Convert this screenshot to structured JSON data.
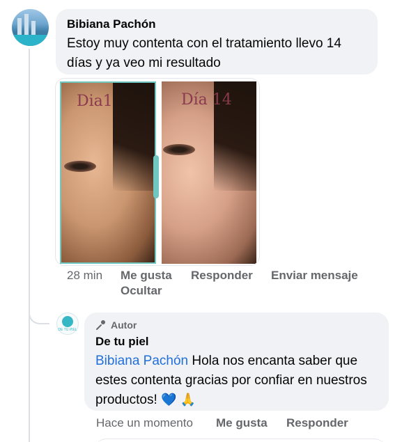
{
  "comment1": {
    "author": "Bibiana Pachón",
    "text": "Estoy muy contenta con el tratamiento llevo 14 días y ya veo mi resultado",
    "photos": [
      {
        "label": "Dia1"
      },
      {
        "label": "Día 14"
      }
    ],
    "actions": {
      "time": "28 min",
      "like": "Me gusta",
      "reply": "Responder",
      "message": "Enviar mensaje",
      "hide": "Ocultar"
    }
  },
  "comment2": {
    "badge": "Autor",
    "author": "De tu piel",
    "avatar_text": "DE TU PIEL",
    "mention": "Bibiana Pachón",
    "text": " Hola nos encanta saber que estes contenta gracias por confiar en nuestros productos! ",
    "emojis": [
      "💙",
      "🙏"
    ],
    "actions": {
      "time": "Hace un momento",
      "like": "Me gusta",
      "reply": "Responder"
    }
  },
  "colors": {
    "bubble": "#f0f2f5",
    "mention": "#216fdb",
    "meta": "#65676b",
    "brand": "#35b7c6"
  }
}
